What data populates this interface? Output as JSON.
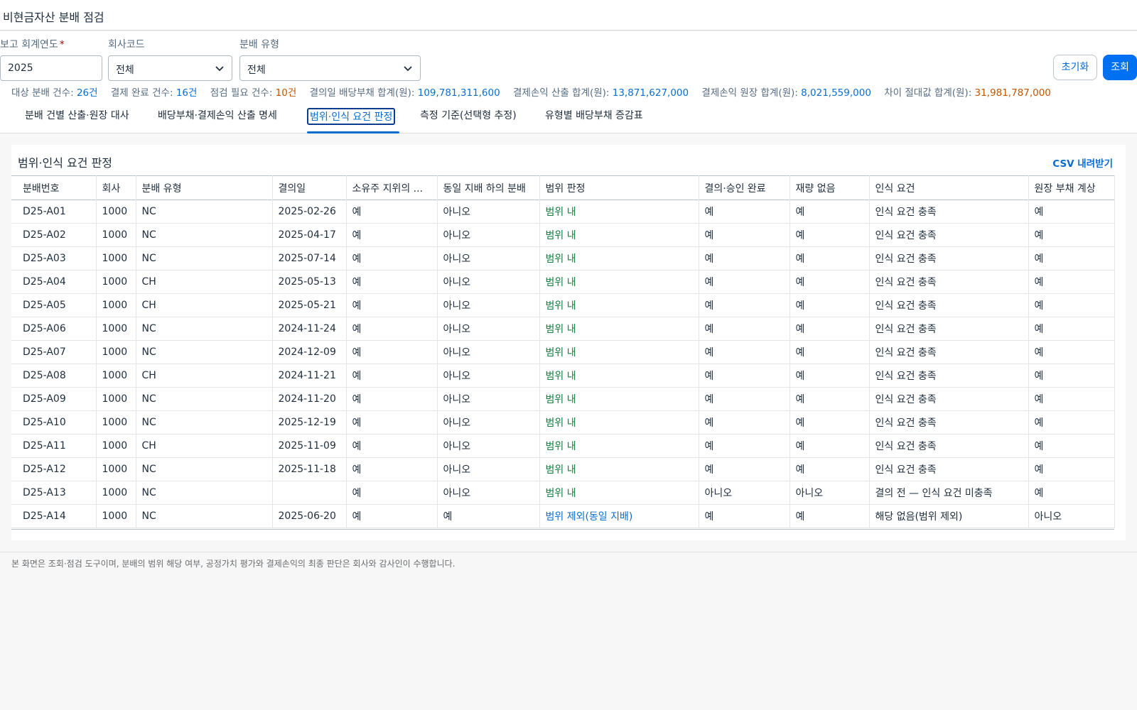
{
  "header": {
    "title": "비현금자산 분배 점검"
  },
  "filters": {
    "year": {
      "label": "보고 회계연도",
      "required_mark": "*",
      "value": "2025"
    },
    "company": {
      "label": "회사코드",
      "value": "전체"
    },
    "dist_type": {
      "label": "분배 유형",
      "value": "전체"
    },
    "reset_label": "초기화",
    "go_label": "조회"
  },
  "kpis": [
    {
      "label": "대상 분배 건수:",
      "value": "26건",
      "tone": "blue"
    },
    {
      "label": "결제 완료 건수:",
      "value": "16건",
      "tone": "blue"
    },
    {
      "label": "점검 필요 건수:",
      "value": "10건",
      "tone": "orange"
    },
    {
      "label": "결의일 배당부채 합계(원):",
      "value": "109,781,311,600",
      "tone": "blue"
    },
    {
      "label": "결제손익 산출 합계(원):",
      "value": "13,871,627,000",
      "tone": "blue"
    },
    {
      "label": "결제손익 원장 합계(원):",
      "value": "8,021,559,000",
      "tone": "blue"
    },
    {
      "label": "차이 절대값 합계(원):",
      "value": "31,981,787,000",
      "tone": "orange"
    }
  ],
  "tabs": [
    {
      "label": "분배 건별 산출·원장 대사",
      "active": false
    },
    {
      "label": "배당부채·결제손익 산출 명세",
      "active": false
    },
    {
      "label": "범위·인식 요건 판정",
      "active": true
    },
    {
      "label": "측정 기준(선택형 추정)",
      "active": false
    },
    {
      "label": "유형별 배당부채 증감표",
      "active": false
    }
  ],
  "panel": {
    "title": "범위·인식 요건 판정",
    "csv_label": "CSV 내려받기"
  },
  "table": {
    "columns": [
      "분배번호",
      "회사",
      "분배 유형",
      "결의일",
      "소유주 지위의 ...",
      "동일 지배 하의 분배",
      "범위 판정",
      "결의·승인 완료",
      "재량 없음",
      "인식 요건",
      "원장 부채 계상"
    ],
    "rows": [
      [
        "D25-A01",
        "1000",
        "NC",
        "2025-02-26",
        "예",
        "아니오",
        "범위 내",
        "예",
        "예",
        "인식 요건 충족",
        "예"
      ],
      [
        "D25-A02",
        "1000",
        "NC",
        "2025-04-17",
        "예",
        "아니오",
        "범위 내",
        "예",
        "예",
        "인식 요건 충족",
        "예"
      ],
      [
        "D25-A03",
        "1000",
        "NC",
        "2025-07-14",
        "예",
        "아니오",
        "범위 내",
        "예",
        "예",
        "인식 요건 충족",
        "예"
      ],
      [
        "D25-A04",
        "1000",
        "CH",
        "2025-05-13",
        "예",
        "아니오",
        "범위 내",
        "예",
        "예",
        "인식 요건 충족",
        "예"
      ],
      [
        "D25-A05",
        "1000",
        "CH",
        "2025-05-21",
        "예",
        "아니오",
        "범위 내",
        "예",
        "예",
        "인식 요건 충족",
        "예"
      ],
      [
        "D25-A06",
        "1000",
        "NC",
        "2024-11-24",
        "예",
        "아니오",
        "범위 내",
        "예",
        "예",
        "인식 요건 충족",
        "예"
      ],
      [
        "D25-A07",
        "1000",
        "NC",
        "2024-12-09",
        "예",
        "아니오",
        "범위 내",
        "예",
        "예",
        "인식 요건 충족",
        "예"
      ],
      [
        "D25-A08",
        "1000",
        "CH",
        "2024-11-21",
        "예",
        "아니오",
        "범위 내",
        "예",
        "예",
        "인식 요건 충족",
        "예"
      ],
      [
        "D25-A09",
        "1000",
        "NC",
        "2024-11-20",
        "예",
        "아니오",
        "범위 내",
        "예",
        "예",
        "인식 요건 충족",
        "예"
      ],
      [
        "D25-A10",
        "1000",
        "NC",
        "2025-12-19",
        "예",
        "아니오",
        "범위 내",
        "예",
        "예",
        "인식 요건 충족",
        "예"
      ],
      [
        "D25-A11",
        "1000",
        "CH",
        "2025-11-09",
        "예",
        "아니오",
        "범위 내",
        "예",
        "예",
        "인식 요건 충족",
        "예"
      ],
      [
        "D25-A12",
        "1000",
        "NC",
        "2025-11-18",
        "예",
        "아니오",
        "범위 내",
        "예",
        "예",
        "인식 요건 충족",
        "예"
      ],
      [
        "D25-A13",
        "1000",
        "NC",
        "",
        "예",
        "아니오",
        "범위 내",
        "아니오",
        "아니오",
        "결의 전 — 인식 요건 미충족",
        "예"
      ],
      [
        "D25-A14",
        "1000",
        "NC",
        "2025-06-20",
        "예",
        "예",
        "범위 제외(동일 지배)",
        "예",
        "예",
        "해당 없음(범위 제외)",
        "아니오"
      ]
    ]
  },
  "footer": {
    "note": "본 화면은 조회·점검 도구이며, 분배의 범위 해당 여부, 공정가치 평가와 결제손익의 최종 판단은 회사와 감사인이 수행합니다."
  },
  "colors": {
    "scope_in": "#107e3e",
    "scope_out": "#0a6ed1",
    "value_blue": "#0a6ed1",
    "value_orange": "#c35500",
    "primary_button": "#0070f2"
  },
  "icons": {
    "select_chevron": "chevron-down-icon"
  }
}
